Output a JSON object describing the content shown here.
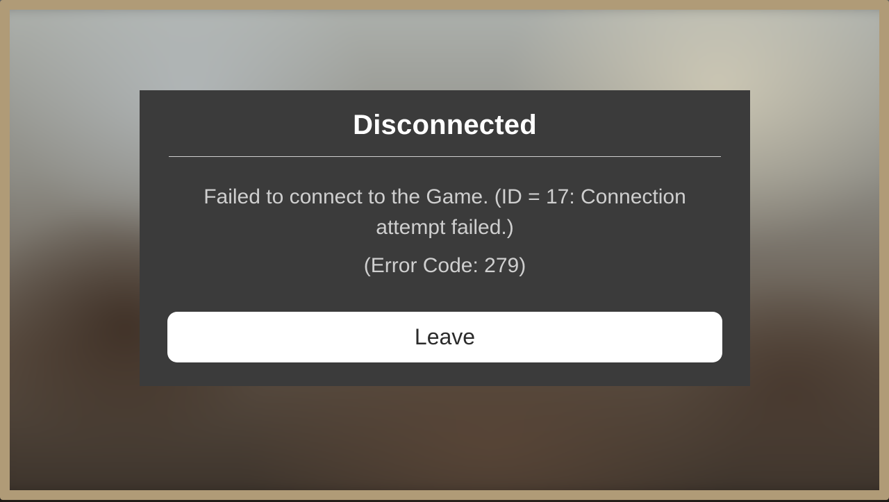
{
  "modal": {
    "title": "Disconnected",
    "message": "Failed to connect to the Game. (ID = 17: Connection attempt failed.)",
    "error_code_line": "(Error Code: 279)",
    "leave_label": "Leave"
  }
}
